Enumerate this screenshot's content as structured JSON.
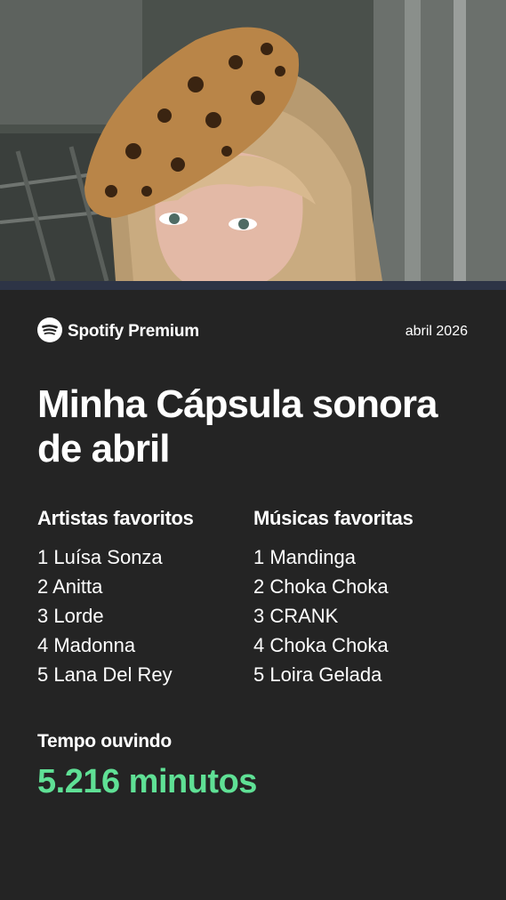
{
  "header": {
    "brand": "Spotify Premium",
    "date": "abril 2026"
  },
  "title": "Minha Cápsula sonora de abril",
  "artists": {
    "heading": "Artistas favoritos",
    "items": [
      "1 Luísa Sonza",
      "2 Anitta",
      "3 Lorde",
      "4 Madonna",
      "5 Lana Del Rey"
    ]
  },
  "songs": {
    "heading": "Músicas favoritas",
    "items": [
      "1 Mandinga",
      "2 Choka Choka",
      "3 CRANK",
      "4 Choka Choka",
      "5 Loira Gelada"
    ]
  },
  "listening": {
    "label": "Tempo ouvindo",
    "value": "5.216 minutos"
  },
  "colors": {
    "background": "#242424",
    "accent_green": "#5fe095",
    "divider": "#2d3446"
  },
  "icons": [
    "spotify-logo-icon"
  ]
}
